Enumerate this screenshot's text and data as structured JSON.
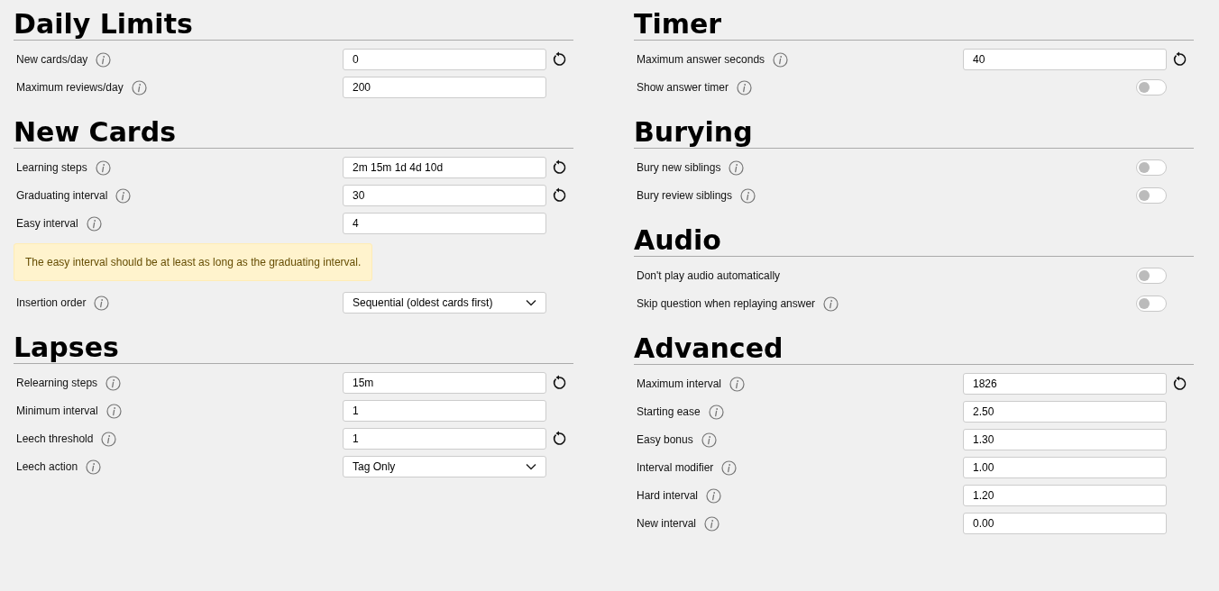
{
  "columns": [
    {
      "sections": [
        {
          "title": "Daily Limits",
          "rows": [
            {
              "kind": "input",
              "label": "New cards/day",
              "info": true,
              "value": "0",
              "reset": true
            },
            {
              "kind": "input",
              "label": "Maximum reviews/day",
              "info": true,
              "value": "200",
              "reset": false
            }
          ]
        },
        {
          "title": "New Cards",
          "rows": [
            {
              "kind": "input",
              "label": "Learning steps",
              "info": true,
              "value": "2m 15m 1d 4d 10d",
              "reset": true
            },
            {
              "kind": "input",
              "label": "Graduating interval",
              "info": true,
              "value": "30",
              "reset": true
            },
            {
              "kind": "input",
              "label": "Easy interval",
              "info": true,
              "value": "4",
              "reset": false
            },
            {
              "kind": "warning",
              "text": "The easy interval should be at least as long as the graduating interval."
            },
            {
              "kind": "select",
              "label": "Insertion order",
              "info": true,
              "value": "Sequential (oldest cards first)",
              "reset": false
            }
          ]
        },
        {
          "title": "Lapses",
          "rows": [
            {
              "kind": "input",
              "label": "Relearning steps",
              "info": true,
              "value": "15m",
              "reset": true
            },
            {
              "kind": "input",
              "label": "Minimum interval",
              "info": true,
              "value": "1",
              "reset": false
            },
            {
              "kind": "input",
              "label": "Leech threshold",
              "info": true,
              "value": "1",
              "reset": true
            },
            {
              "kind": "select",
              "label": "Leech action",
              "info": true,
              "value": "Tag Only",
              "reset": false
            }
          ]
        }
      ]
    },
    {
      "sections": [
        {
          "title": "Timer",
          "rows": [
            {
              "kind": "input",
              "label": "Maximum answer seconds",
              "info": true,
              "value": "40",
              "reset": true
            },
            {
              "kind": "toggle",
              "label": "Show answer timer",
              "info": true,
              "on": false
            }
          ]
        },
        {
          "title": "Burying",
          "rows": [
            {
              "kind": "toggle",
              "label": "Bury new siblings",
              "info": true,
              "on": false
            },
            {
              "kind": "toggle",
              "label": "Bury review siblings",
              "info": true,
              "on": false
            }
          ]
        },
        {
          "title": "Audio",
          "rows": [
            {
              "kind": "toggle",
              "label": "Don't play audio automatically",
              "info": false,
              "on": false
            },
            {
              "kind": "toggle",
              "label": "Skip question when replaying answer",
              "info": true,
              "on": false
            }
          ]
        },
        {
          "title": "Advanced",
          "rows": [
            {
              "kind": "input",
              "label": "Maximum interval",
              "info": true,
              "value": "1826",
              "reset": true
            },
            {
              "kind": "input",
              "label": "Starting ease",
              "info": true,
              "value": "2.50",
              "reset": false
            },
            {
              "kind": "input",
              "label": "Easy bonus",
              "info": true,
              "value": "1.30",
              "reset": false
            },
            {
              "kind": "input",
              "label": "Interval modifier",
              "info": true,
              "value": "1.00",
              "reset": false
            },
            {
              "kind": "input",
              "label": "Hard interval",
              "info": true,
              "value": "1.20",
              "reset": false
            },
            {
              "kind": "input",
              "label": "New interval",
              "info": true,
              "value": "0.00",
              "reset": false
            }
          ]
        }
      ]
    }
  ]
}
